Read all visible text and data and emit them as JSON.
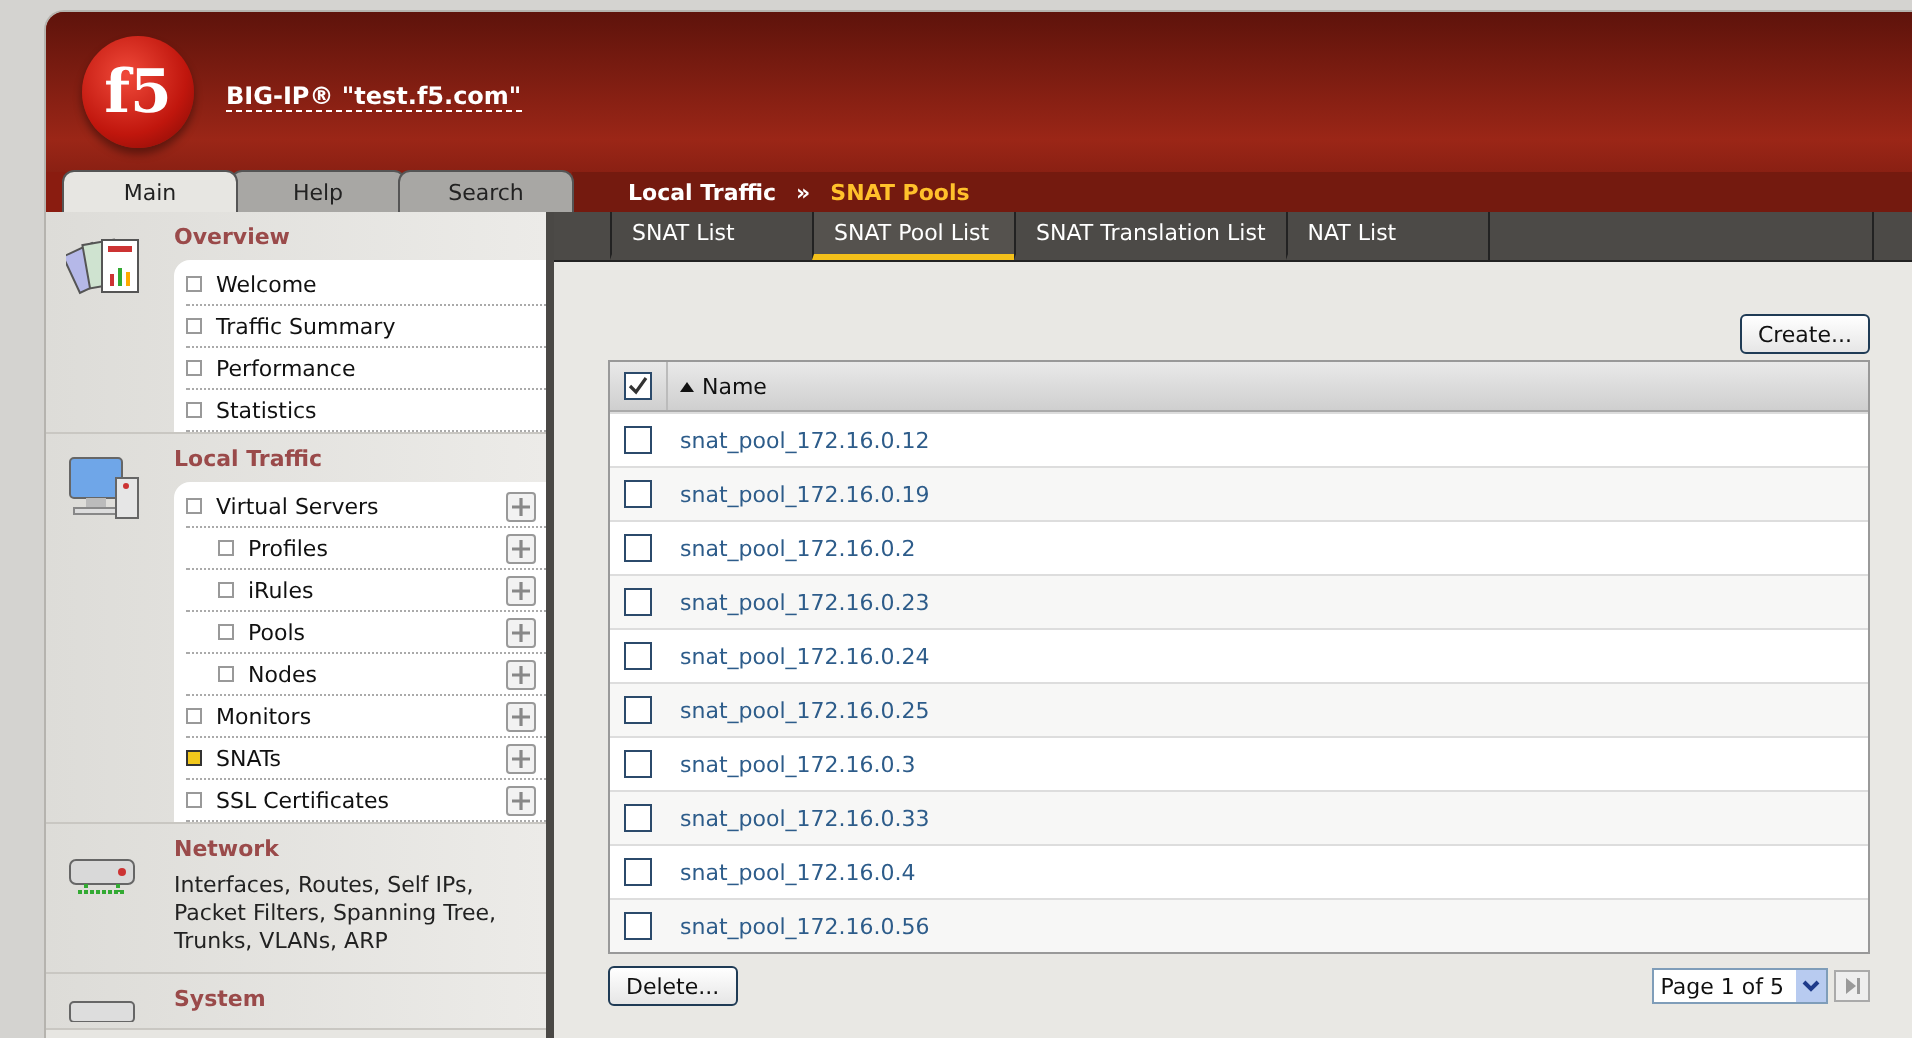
{
  "header": {
    "logo": "f5",
    "device": "BIG-IP® \"test.f5.com\""
  },
  "nav_tabs": [
    {
      "label": "Main",
      "selected": true
    },
    {
      "label": "Help",
      "selected": false
    },
    {
      "label": "Search",
      "selected": false
    }
  ],
  "breadcrumb": {
    "section": "Local Traffic",
    "separator": "»",
    "page": "SNAT Pools"
  },
  "sub_tabs": [
    {
      "label": "SNAT List",
      "selected": false
    },
    {
      "label": "SNAT Pool List",
      "selected": true
    },
    {
      "label": "SNAT Translation List",
      "selected": false
    },
    {
      "label": "NAT List",
      "selected": false
    }
  ],
  "sidebar": {
    "sections": [
      {
        "kind": "list",
        "title": "Overview",
        "items": [
          {
            "label": "Welcome",
            "selected": false,
            "addable": false
          },
          {
            "label": "Traffic Summary",
            "selected": false,
            "addable": false
          },
          {
            "label": "Performance",
            "selected": false,
            "addable": false
          },
          {
            "label": "Statistics",
            "selected": false,
            "addable": false
          }
        ]
      },
      {
        "kind": "list",
        "title": "Local Traffic",
        "items": [
          {
            "label": "Virtual Servers",
            "selected": false,
            "addable": true,
            "children": [
              {
                "label": "Profiles",
                "selected": false,
                "addable": true
              },
              {
                "label": "iRules",
                "selected": false,
                "addable": true
              },
              {
                "label": "Pools",
                "selected": false,
                "addable": true
              },
              {
                "label": "Nodes",
                "selected": false,
                "addable": true
              }
            ]
          },
          {
            "label": "Monitors",
            "selected": false,
            "addable": true
          },
          {
            "label": "SNATs",
            "selected": true,
            "addable": true
          },
          {
            "label": "SSL Certificates",
            "selected": false,
            "addable": true
          }
        ]
      },
      {
        "kind": "text",
        "title": "Network",
        "description": "Interfaces, Routes, Self IPs, Packet Filters, Spanning Tree, Trunks, VLANs, ARP"
      },
      {
        "kind": "text",
        "title": "System"
      }
    ]
  },
  "create_button": "Create...",
  "table": {
    "all_checked": true,
    "columns": [
      {
        "label": "Name",
        "sorted": true
      }
    ],
    "rows": [
      {
        "name": "snat_pool_172.16.0.12",
        "checked": false
      },
      {
        "name": "snat_pool_172.16.0.19",
        "checked": false
      },
      {
        "name": "snat_pool_172.16.0.2",
        "checked": false
      },
      {
        "name": "snat_pool_172.16.0.23",
        "checked": false
      },
      {
        "name": "snat_pool_172.16.0.24",
        "checked": false
      },
      {
        "name": "snat_pool_172.16.0.25",
        "checked": false
      },
      {
        "name": "snat_pool_172.16.0.3",
        "checked": false
      },
      {
        "name": "snat_pool_172.16.0.33",
        "checked": false
      },
      {
        "name": "snat_pool_172.16.0.4",
        "checked": false
      },
      {
        "name": "snat_pool_172.16.0.56",
        "checked": false
      }
    ]
  },
  "delete_button": "Delete...",
  "pager": {
    "value": "Page 1 of 5"
  }
}
